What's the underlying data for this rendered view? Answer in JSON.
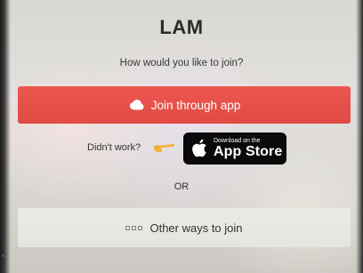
{
  "app": {
    "title": "LAM",
    "prompt": "How would you like to join?"
  },
  "join_app_button": {
    "label": "Join through app",
    "icon": "cloud-icon",
    "color": "#e24c46"
  },
  "fallback": {
    "text": "Didn't work?",
    "icon": "pointing-hand-icon"
  },
  "app_store_badge": {
    "small_text": "Download on the",
    "large_text": "App Store",
    "icon": "apple-logo-icon"
  },
  "divider": {
    "text": "OR"
  },
  "other_ways_button": {
    "label": "Other ways to join",
    "icon": "dots-icon"
  }
}
